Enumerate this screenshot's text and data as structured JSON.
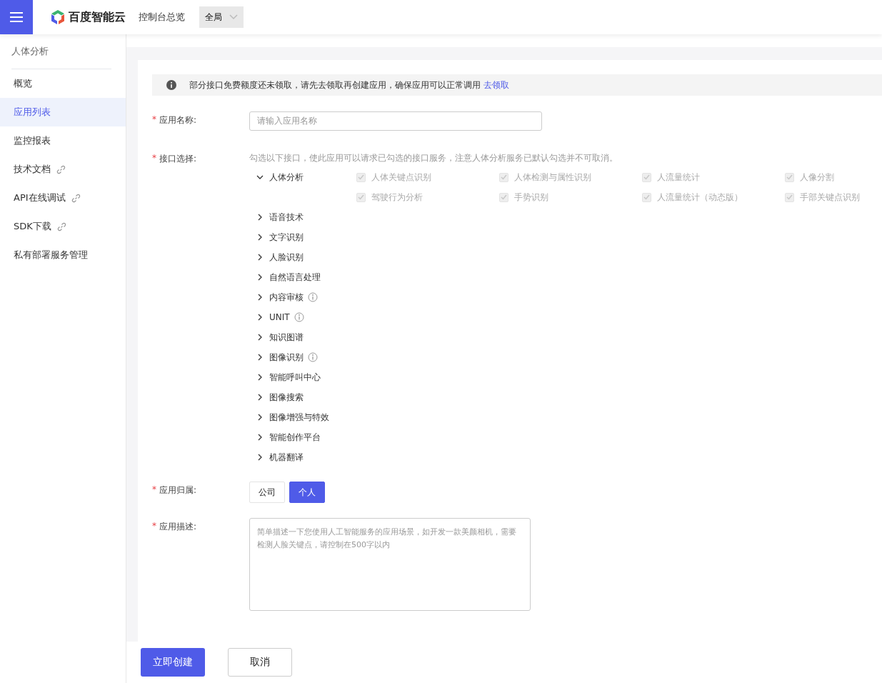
{
  "header": {
    "brand": "百度智能云",
    "nav_link": "控制台总览",
    "region_select": "全局"
  },
  "sidebar": {
    "title": "人体分析",
    "items": [
      {
        "label": "概览",
        "selected": false,
        "external": false
      },
      {
        "label": "应用列表",
        "selected": true,
        "external": false
      },
      {
        "label": "监控报表",
        "selected": false,
        "external": false
      },
      {
        "label": "技术文档",
        "selected": false,
        "external": true
      },
      {
        "label": "API在线调试",
        "selected": false,
        "external": true
      },
      {
        "label": "SDK下载",
        "selected": false,
        "external": true
      },
      {
        "label": "私有部署服务管理",
        "selected": false,
        "external": false
      }
    ]
  },
  "notice": {
    "text": "部分接口免费额度还未领取，请先去领取再创建应用，确保应用可以正常调用",
    "link": "去领取"
  },
  "form": {
    "name": {
      "label": "应用名称:",
      "required_mark": "*",
      "placeholder": "请输入应用名称"
    },
    "apis": {
      "label": "接口选择:",
      "required_mark": "*",
      "hint": "勾选以下接口，使此应用可以请求已勾选的接口服务，注意人体分析服务已默认勾选并不可取消。",
      "groups": [
        {
          "label": "人体分析",
          "expanded": true,
          "info": false,
          "options": [
            {
              "label": "人体关键点识别",
              "checked": true,
              "disabled": true
            },
            {
              "label": "人体检测与属性识别",
              "checked": true,
              "disabled": true
            },
            {
              "label": "人流量统计",
              "checked": true,
              "disabled": true
            },
            {
              "label": "人像分割",
              "checked": true,
              "disabled": true
            },
            {
              "label": "驾驶行为分析",
              "checked": true,
              "disabled": true
            },
            {
              "label": "手势识别",
              "checked": true,
              "disabled": true
            },
            {
              "label": "人流量统计（动态版）",
              "checked": true,
              "disabled": true
            },
            {
              "label": "手部关键点识别",
              "checked": true,
              "disabled": true
            }
          ]
        },
        {
          "label": "语音技术",
          "expanded": false,
          "info": false
        },
        {
          "label": "文字识别",
          "expanded": false,
          "info": false
        },
        {
          "label": "人脸识别",
          "expanded": false,
          "info": false
        },
        {
          "label": "自然语言处理",
          "expanded": false,
          "info": false
        },
        {
          "label": "内容审核",
          "expanded": false,
          "info": true
        },
        {
          "label": "UNIT",
          "expanded": false,
          "info": true
        },
        {
          "label": "知识图谱",
          "expanded": false,
          "info": false
        },
        {
          "label": "图像识别",
          "expanded": false,
          "info": true
        },
        {
          "label": "智能呼叫中心",
          "expanded": false,
          "info": false
        },
        {
          "label": "图像搜索",
          "expanded": false,
          "info": false
        },
        {
          "label": "图像增强与特效",
          "expanded": false,
          "info": false
        },
        {
          "label": "智能创作平台",
          "expanded": false,
          "info": false
        },
        {
          "label": "机器翻译",
          "expanded": false,
          "info": false
        }
      ]
    },
    "owner": {
      "label": "应用归属:",
      "required_mark": "*",
      "options": [
        {
          "label": "公司",
          "selected": false
        },
        {
          "label": "个人",
          "selected": true
        }
      ]
    },
    "description": {
      "label": "应用描述:",
      "required_mark": "*",
      "placeholder": "简单描述一下您使用人工智能服务的应用场景，如开发一款美颜相机，需要检测人脸关键点，请控制在500字以内"
    }
  },
  "footer": {
    "submit": "立即创建",
    "cancel": "取消"
  }
}
